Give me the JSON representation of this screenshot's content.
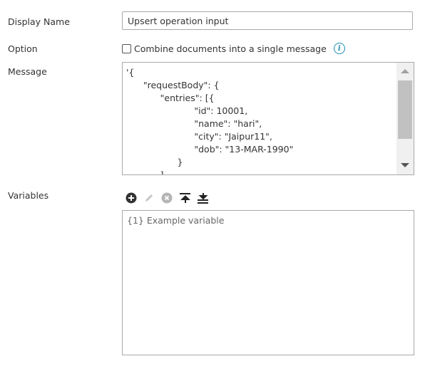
{
  "display_name": {
    "label": "Display Name",
    "value": "Upsert operation input"
  },
  "option": {
    "label": "Option",
    "checkbox_label": "Combine documents into a single message",
    "checked": false,
    "info_icon": "info-icon"
  },
  "message": {
    "label": "Message",
    "lines": [
      "'{",
      "      \"requestBody\": {",
      "            \"entries\": [{",
      "                        \"id\": 10001,",
      "                        \"name\": \"hari\",",
      "                        \"city\": \"Jaipur11\",",
      "                        \"dob\": \"13-MAR-1990\"",
      "                  }",
      "            ]"
    ]
  },
  "variables": {
    "label": "Variables",
    "toolbar": [
      "add-icon",
      "edit-icon",
      "remove-icon",
      "move-top-icon",
      "move-bottom-icon"
    ],
    "items": [
      "{1} Example variable"
    ]
  }
}
